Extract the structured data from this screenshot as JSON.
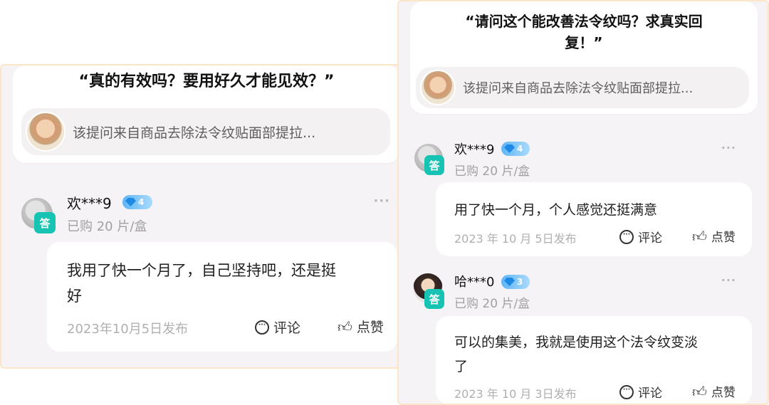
{
  "left_panel": {
    "question": "“真的有效吗？要用好久才能见效？”",
    "source": "该提问来自商品去除法令纹贴面部提拉...",
    "answers": [
      {
        "username": "欢***9",
        "level": "4",
        "answer_badge": "答",
        "purchase": "已购 20 片/盒",
        "content_line1": "我用了快一个月了，自己坚持吧，还是挺",
        "content_line2": "好",
        "date": "2023年10月5日发布",
        "comment_label": "评论",
        "like_label": "点赞",
        "more": "···"
      }
    ]
  },
  "right_panel": {
    "question_line1": "“请问这个能改善法令纹吗？求真实回",
    "question_line2": "复！”",
    "source": "该提问来自商品去除法令纹贴面部提拉...",
    "answers": [
      {
        "username": "欢***9",
        "level": "4",
        "answer_badge": "答",
        "purchase": "已购 20 片/盒",
        "content_line1": "用了快一个月，个人感觉还挺满意",
        "date": "2023 年 10 月 5日发布",
        "comment_label": "评论",
        "like_label": "点赞",
        "more": "···"
      },
      {
        "username": "哈***0",
        "level": "3",
        "answer_badge": "答",
        "purchase": "已购 20 片/盒",
        "content_line1": "可以的集美，我就是使用这个法令纹变淡",
        "content_line2": "了",
        "date": "2023 年 10 月 3日发布",
        "comment_label": "评论",
        "like_label": "点赞",
        "more": "···"
      }
    ]
  },
  "colors": {
    "panel_bg": "#f6f3f7",
    "panel_border": "#fbe6c8",
    "answer_badge": "#17c3b2",
    "level_badge": "#5fb5f5"
  },
  "icons": [
    "product-thumbnail",
    "user-avatar",
    "diamond-icon",
    "comment-icon",
    "thumbs-up-icon",
    "more-icon"
  ]
}
